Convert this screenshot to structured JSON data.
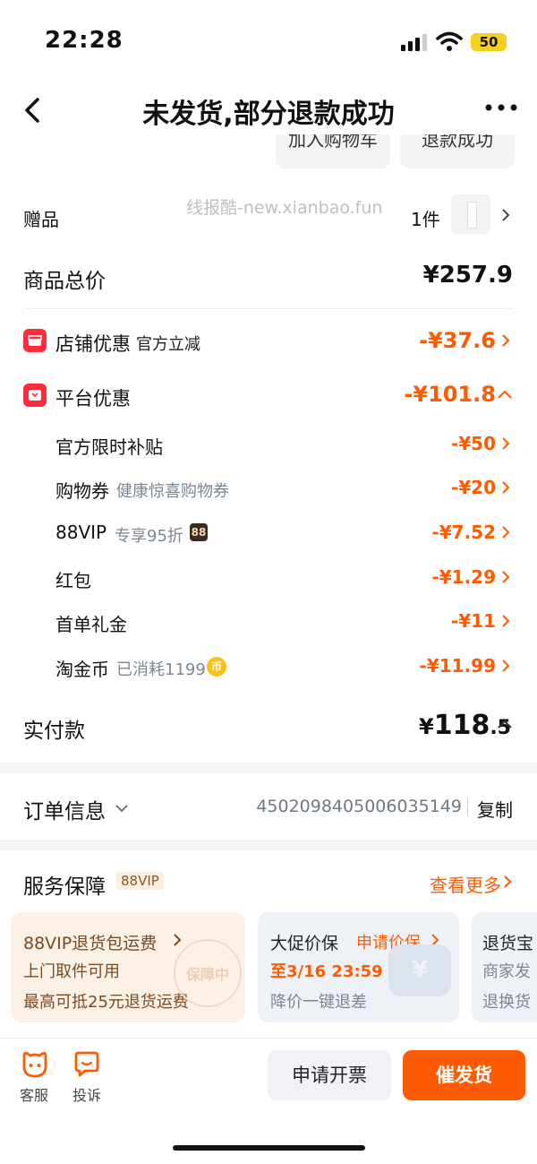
{
  "status": {
    "time": "22:28",
    "battery": "50"
  },
  "nav": {
    "title": "未发货,部分退款成功"
  },
  "top_pills": [
    "加入购物车",
    "退款成功"
  ],
  "watermark": "线报酷-new.xianbao.fun",
  "gift": {
    "label": "赠品",
    "count": "1件"
  },
  "total": {
    "label": "商品总价",
    "value": "¥257.9"
  },
  "store_discount": {
    "label": "店铺优惠",
    "sub": "官方立减",
    "value": "-¥37.6"
  },
  "platform_discount": {
    "label": "平台优惠",
    "value": "-¥101.8",
    "items": [
      {
        "label": "官方限时补贴",
        "sub": "",
        "value": "-¥50"
      },
      {
        "label": "购物券",
        "sub": "健康惊喜购物券",
        "value": "-¥20"
      },
      {
        "label": "88VIP",
        "sub": "专享95折",
        "badge": "88",
        "value": "-¥7.52"
      },
      {
        "label": "红包",
        "sub": "",
        "value": "-¥1.29"
      },
      {
        "label": "首单礼金",
        "sub": "",
        "value": "-¥11"
      },
      {
        "label": "淘金币",
        "sub": "已消耗1199",
        "badge": "币",
        "value": "-¥11.99"
      }
    ]
  },
  "paid": {
    "label": "实付款",
    "currency": "¥",
    "int": "118",
    "dec": ".5"
  },
  "order": {
    "label": "订单信息",
    "number": "4502098405006035149",
    "copy": "复制"
  },
  "service": {
    "title": "服务保障",
    "badge": "88VIP",
    "more": "查看更多",
    "cards": [
      {
        "title": "88VIP退货包运费",
        "line1": "上门取件可用",
        "line2": "最高可抵25元退货运费",
        "stamp": "保障中"
      },
      {
        "title": "大促价保",
        "action": "申请价保",
        "line1": "至3/16 23:59",
        "line2": "降价一键退差"
      },
      {
        "title": "退货宝",
        "line1": "商家发",
        "line2": "退换货"
      }
    ]
  },
  "bottom": {
    "service_label": "客服",
    "complain_label": "投诉",
    "invoice_button": "申请开票",
    "urge_button": "催发货"
  },
  "colors": {
    "accent": "#ff5a00",
    "red_icon": "#ff2a3c"
  }
}
